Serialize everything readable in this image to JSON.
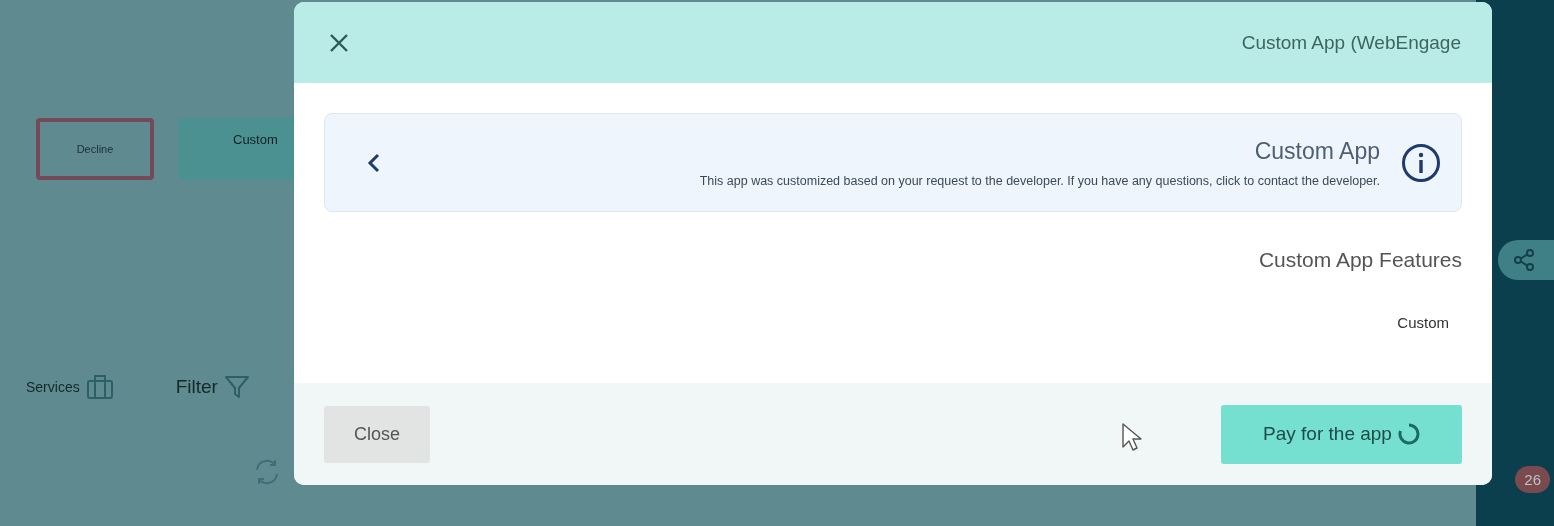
{
  "background": {
    "decline_button": "Decline",
    "custom_tile": "Custom",
    "services_label": "Services",
    "filter_label": "Filter",
    "notification_count": "26"
  },
  "dialog": {
    "title": "Custom App (WebEngage",
    "info_card": {
      "title": "Custom App",
      "description": "This app was customized based on your request to the developer. If you have any questions, click to contact the developer."
    },
    "features_heading": "Custom App Features",
    "features": [
      {
        "label": "Custom"
      }
    ],
    "buttons": [
      {
        "label": "Close",
        "kind": "secondary",
        "loading": false
      },
      {
        "label": "Pay for the app",
        "kind": "primary",
        "loading": true
      }
    ]
  }
}
